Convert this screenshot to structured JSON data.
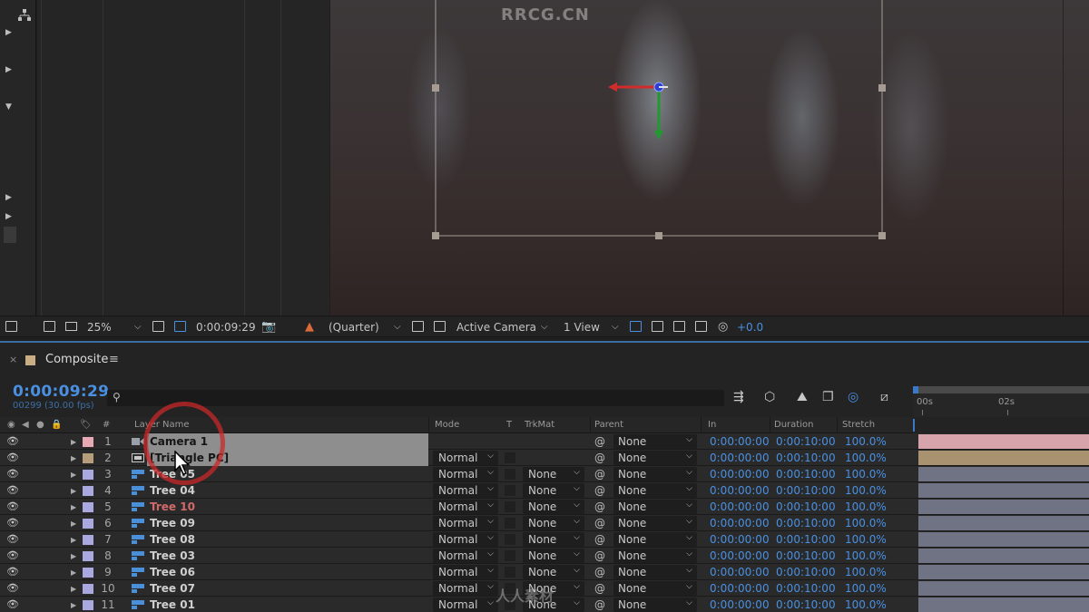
{
  "viewer": {
    "watermark": "RRCG.CN"
  },
  "viewer_toolbar": {
    "zoom": "25%",
    "timecode": "0:00:09:29",
    "resolution": "(Quarter)",
    "camera": "Active Camera",
    "views": "1 View",
    "exposure": "+0.0"
  },
  "timeline": {
    "comp_name": "Composite",
    "menu_glyph": "≡",
    "timecode": "0:00:09:29",
    "frame_info": "00299 (30.00 fps)",
    "ruler_labels": [
      "00s",
      "02s"
    ],
    "columns": {
      "num": "#",
      "layer_name": "Layer Name",
      "mode": "Mode",
      "t": "T",
      "trkmat": "TrkMat",
      "parent": "Parent",
      "in": "In",
      "duration": "Duration",
      "stretch": "Stretch"
    },
    "layers": [
      {
        "num": "1",
        "name": "Camera 1",
        "mode": "",
        "trkmat": "",
        "parent": "None",
        "in": "0:00:00:00",
        "duration": "0:00:10:00",
        "stretch": "100.0%",
        "label_color": "#e7a9b3",
        "bar_color": "#d7a4ab",
        "type": "camera"
      },
      {
        "num": "2",
        "name": "[Triangle PC]",
        "mode": "Normal",
        "trkmat": "",
        "parent": "None",
        "in": "0:00:00:00",
        "duration": "0:00:10:00",
        "stretch": "100.0%",
        "label_color": "#b69e7a",
        "bar_color": "#a89270",
        "type": "precomp"
      },
      {
        "num": "3",
        "name": "Tree 05",
        "mode": "Normal",
        "trkmat": "None",
        "parent": "None",
        "in": "0:00:00:00",
        "duration": "0:00:10:00",
        "stretch": "100.0%",
        "label_color": "#a9a9e0",
        "bar_color": "#6f7384",
        "type": "footage"
      },
      {
        "num": "4",
        "name": "Tree 04",
        "mode": "Normal",
        "trkmat": "None",
        "parent": "None",
        "in": "0:00:00:00",
        "duration": "0:00:10:00",
        "stretch": "100.0%",
        "label_color": "#a9a9e0",
        "bar_color": "#6f7384",
        "type": "footage"
      },
      {
        "num": "5",
        "name": "Tree 10",
        "mode": "Normal",
        "trkmat": "None",
        "parent": "None",
        "in": "0:00:00:00",
        "duration": "0:00:10:00",
        "stretch": "100.0%",
        "label_color": "#a9a9e0",
        "bar_color": "#6f7384",
        "type": "footage"
      },
      {
        "num": "6",
        "name": "Tree 09",
        "mode": "Normal",
        "trkmat": "None",
        "parent": "None",
        "in": "0:00:00:00",
        "duration": "0:00:10:00",
        "stretch": "100.0%",
        "label_color": "#a9a9e0",
        "bar_color": "#6f7384",
        "type": "footage"
      },
      {
        "num": "7",
        "name": "Tree 08",
        "mode": "Normal",
        "trkmat": "None",
        "parent": "None",
        "in": "0:00:00:00",
        "duration": "0:00:10:00",
        "stretch": "100.0%",
        "label_color": "#a9a9e0",
        "bar_color": "#6f7384",
        "type": "footage"
      },
      {
        "num": "8",
        "name": "Tree 03",
        "mode": "Normal",
        "trkmat": "None",
        "parent": "None",
        "in": "0:00:00:00",
        "duration": "0:00:10:00",
        "stretch": "100.0%",
        "label_color": "#a9a9e0",
        "bar_color": "#6f7384",
        "type": "footage"
      },
      {
        "num": "9",
        "name": "Tree 06",
        "mode": "Normal",
        "trkmat": "None",
        "parent": "None",
        "in": "0:00:00:00",
        "duration": "0:00:10:00",
        "stretch": "100.0%",
        "label_color": "#a9a9e0",
        "bar_color": "#6f7384",
        "type": "footage"
      },
      {
        "num": "10",
        "name": "Tree 07",
        "mode": "Normal",
        "trkmat": "None",
        "parent": "None",
        "in": "0:00:00:00",
        "duration": "0:00:10:00",
        "stretch": "100.0%",
        "label_color": "#a9a9e0",
        "bar_color": "#6f7384",
        "type": "footage"
      },
      {
        "num": "11",
        "name": "Tree 01",
        "mode": "Normal",
        "trkmat": "None",
        "parent": "None",
        "in": "0:00:00:00",
        "duration": "0:00:10:00",
        "stretch": "100.0%",
        "label_color": "#a9a9e0",
        "bar_color": "#6f7384",
        "type": "footage"
      }
    ],
    "selected_layer": "2",
    "red_layer": "5"
  },
  "watermark_bottom": "人人素材",
  "colors": {
    "accent_blue": "#4a90e2",
    "selection_red_circle": "#c82828",
    "background": "#1f1f1f"
  },
  "icons": {
    "camera_layer": "camera-icon",
    "precomp_layer": "precomp-icon",
    "footage_layer": "footage-icon",
    "visibility": "eye-icon",
    "parent_pick": "pickwhip-icon"
  }
}
